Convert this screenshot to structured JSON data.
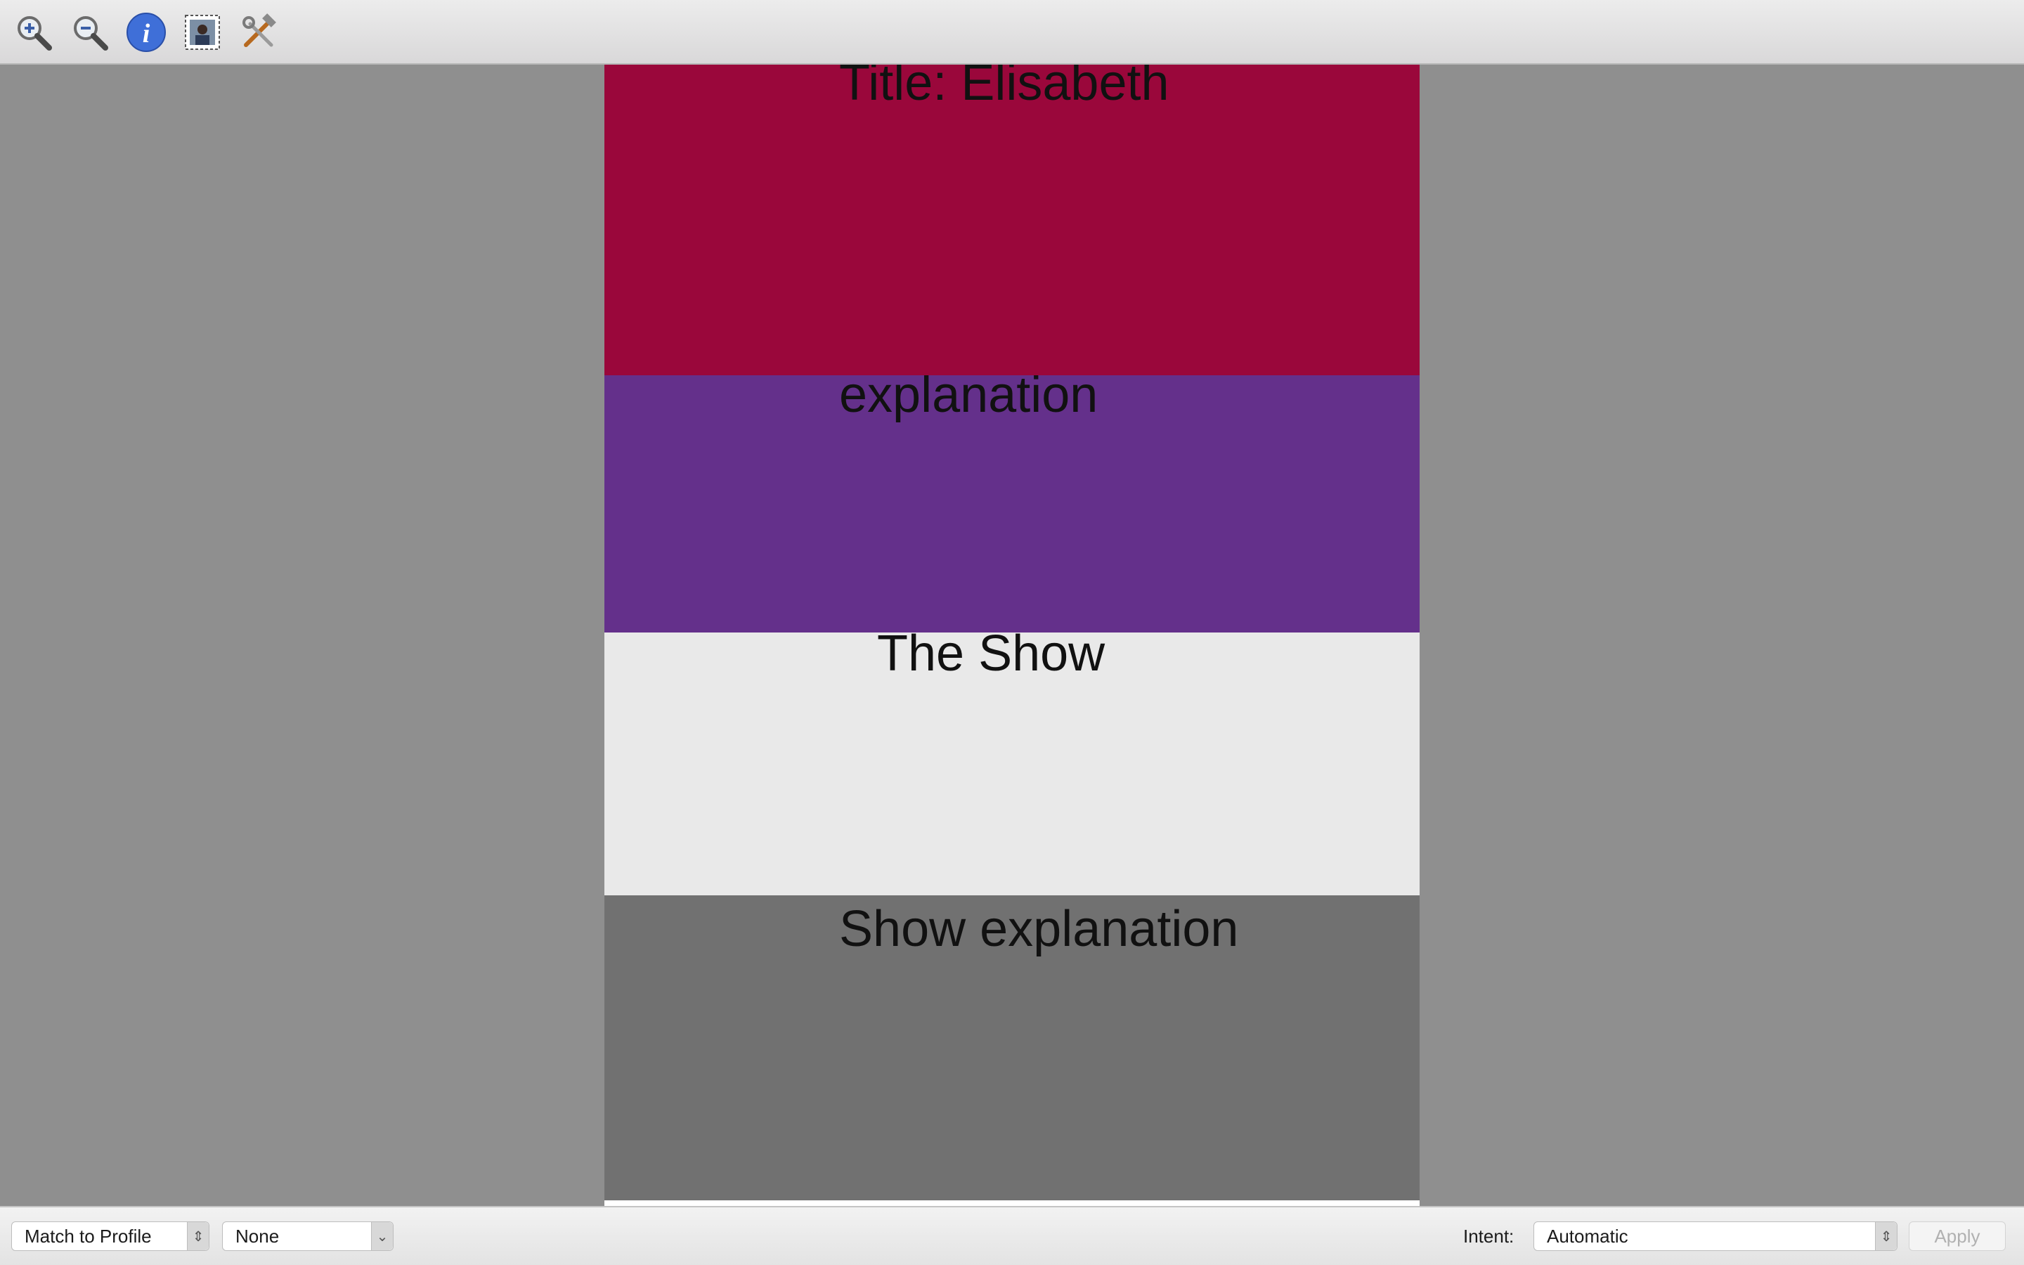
{
  "toolbar": {
    "buttons": [
      {
        "icon": "zoom-in-icon"
      },
      {
        "icon": "zoom-out-icon"
      },
      {
        "icon": "info-icon"
      },
      {
        "icon": "image-crop-icon"
      },
      {
        "icon": "tools-icon"
      }
    ]
  },
  "document": {
    "bands": [
      {
        "text": "Title: Elisabeth",
        "color": "#9a073b"
      },
      {
        "text": "explanation",
        "color": "#64308b"
      },
      {
        "text": "The Show",
        "color": "#e9e9e9"
      },
      {
        "text": "Show explanation",
        "color": "#717171"
      }
    ]
  },
  "bottombar": {
    "profile_select": "Match to Profile",
    "second_select": "None",
    "intent_label": "Intent:",
    "intent_select": "Automatic",
    "apply_label": "Apply"
  }
}
